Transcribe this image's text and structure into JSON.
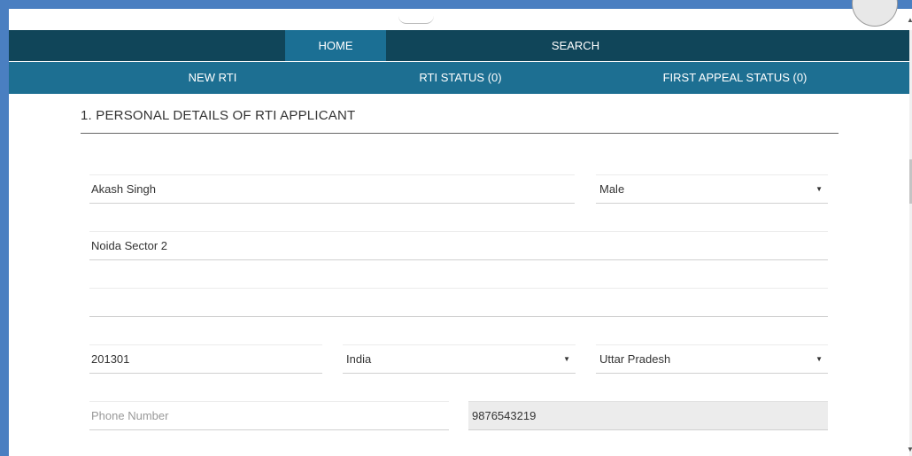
{
  "nav_primary": {
    "home": "HOME",
    "search": "SEARCH"
  },
  "nav_secondary": {
    "new_rti": "NEW RTI",
    "rti_status": "RTI STATUS (0)",
    "first_appeal_status": "FIRST APPEAL STATUS (0)"
  },
  "section": {
    "title": "1. PERSONAL DETAILS OF RTI APPLICANT"
  },
  "form": {
    "name": "Akash Singh",
    "gender": "Male",
    "address_line1": "Noida Sector 2",
    "address_line2": "",
    "pincode": "201301",
    "country": "India",
    "state": "Uttar Pradesh",
    "phone_placeholder": "Phone Number",
    "mobile": "9876543219"
  },
  "icons": {
    "dropdown": "chevron-down-icon",
    "caret_glyph": "▼"
  },
  "colors": {
    "nav_primary_bg": "#104559",
    "nav_active_bg": "#1b6f94",
    "nav_secondary_bg": "#1d6f92",
    "window_frame": "#4a7fc1"
  }
}
